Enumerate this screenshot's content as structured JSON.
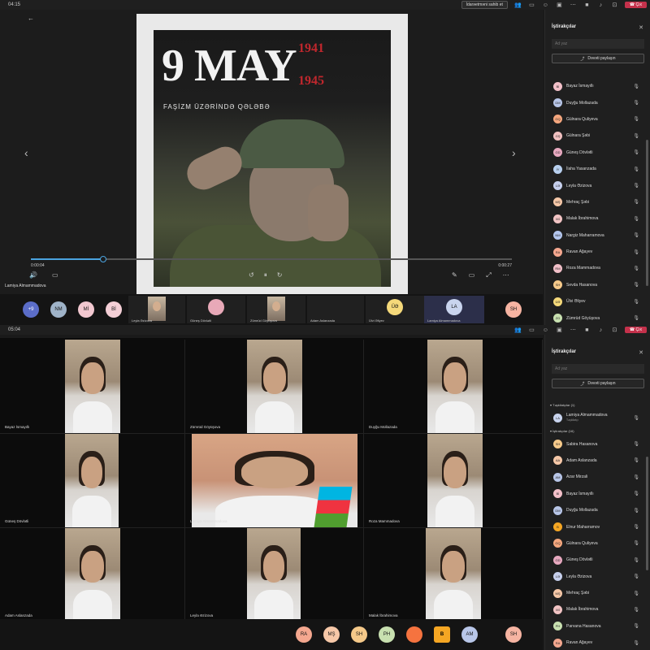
{
  "top": {
    "timer": "04:15",
    "stop_presenting": "İdarəetməni sahib et",
    "leave": "Çıx",
    "presenter_name": "Lamiya Almammadova",
    "poster": {
      "title": "9 MAY",
      "year1": "1941",
      "year2": "1945",
      "subtitle": "FAŞİZM ÜZƏRİNDƏ QƏLƏBƏ"
    },
    "video": {
      "elapsed": "0:00:04",
      "total": "0:00:27",
      "progress": 0.15
    },
    "gallery": {
      "overflow": "+9",
      "avatars": [
        {
          "initials": "NM",
          "color": "#9fb3c8"
        },
        {
          "initials": "Mİ",
          "color": "#f2c8d0"
        },
        {
          "initials": "Bİ",
          "color": "#f4cfd6"
        }
      ],
      "tiles": [
        {
          "name": "Leyla Əzizova"
        },
        {
          "name": "Güneş Dövlətli",
          "initials": "",
          "color": "#e8a9b8"
        },
        {
          "name": "Zümrüd Göyüşova"
        },
        {
          "name": "Adam Aslanzada"
        },
        {
          "name": "Ülvi Əliyev",
          "initials": "ÜƏ",
          "color": "#f5d97a"
        },
        {
          "name": "Lamiya Almammadova",
          "initials": "LA",
          "color": "#c9d4ee"
        }
      ],
      "last_avatar": {
        "initials": "SH",
        "color": "#f6b4a2"
      }
    },
    "panel": {
      "title": "İştirakçılar",
      "search_placeholder": "Ad yaz",
      "share": "Dəvəti paylaşın",
      "people": [
        {
          "name": "Bayaz İsmayıllı",
          "initials": "Bİ",
          "color": "#f3c0c9"
        },
        {
          "name": "Duyğu Mollazada",
          "initials": "DM",
          "color": "#b8c6e8"
        },
        {
          "name": "Gülnara Quliyeva",
          "initials": "GQ",
          "color": "#f5a77e"
        },
        {
          "name": "Gülnara Şəbi",
          "initials": "GŞ",
          "color": "#f2c1c1"
        },
        {
          "name": "Güneş Dövlətli",
          "initials": "GD",
          "color": "#e8a9c0"
        },
        {
          "name": "İlaha Yasanzada",
          "initials": "İY",
          "color": "#b8d0ef"
        },
        {
          "name": "Leyla Əzizova",
          "initials": "LƏ",
          "color": "#c6cfec"
        },
        {
          "name": "Mehraç Şəbi",
          "initials": "MŞ",
          "color": "#f6c8a8"
        },
        {
          "name": "Malak İbrahimova",
          "initials": "Mİ",
          "color": "#f2c4c4"
        },
        {
          "name": "Nargiz Maharramova",
          "initials": "NM",
          "color": "#b4c6ee"
        },
        {
          "name": "Ravan Ağayev",
          "initials": "RA",
          "color": "#f4a78f"
        },
        {
          "name": "Roza Mammadova",
          "initials": "RM",
          "color": "#f2c0c9"
        },
        {
          "name": "Sevda Hasanova",
          "initials": "SH",
          "color": "#f5c98a"
        },
        {
          "name": "Ülvi Əliyev",
          "initials": "ÜƏ",
          "color": "#f5d97a"
        },
        {
          "name": "Zümrüd Göyüşova",
          "initials": "ZG",
          "color": "#c8e0b0"
        }
      ]
    }
  },
  "bottom": {
    "timer": "05:04",
    "leave": "Çıx",
    "cells": [
      {
        "name": "Bayaz İsmayıllı"
      },
      {
        "name": "Zümrüd Göyüşova"
      },
      {
        "name": "Duyğu Mollazada"
      },
      {
        "name": "Güneş Dövlətli"
      },
      {
        "name": "Lamiya Almammadova"
      },
      {
        "name": "Roza Mammadova"
      },
      {
        "name": "Adam Aslanzada"
      },
      {
        "name": "Leyla Əzizova"
      },
      {
        "name": "Malak İbrahimova"
      }
    ],
    "strip": [
      {
        "initials": "RA",
        "color": "#f4a78f"
      },
      {
        "initials": "MŞ",
        "color": "#f6c8a8"
      },
      {
        "initials": "SH",
        "color": "#f5c98a"
      },
      {
        "initials": "PH",
        "color": "#c8e0b0"
      },
      {
        "initials": "",
        "color": "#f5733f"
      },
      {
        "initials": "B",
        "color": "#f5a623"
      },
      {
        "initials": "AM",
        "color": "#b8c6e8"
      },
      {
        "initials": "SH",
        "color": "#f6b4a2"
      }
    ],
    "panel": {
      "title": "İştirakçılar",
      "search_placeholder": "Ad yaz",
      "share": "Dəvəti paylaşın",
      "organizers_label": "Təşkilatçılar (1)",
      "organizer": {
        "name": "Lamiya Almammadova",
        "role": "Təşkilatçı",
        "initials": "LA",
        "color": "#c9d4ee"
      },
      "attendees_label": "İştirakçılar (16)",
      "people": [
        {
          "name": "Sabira Hasanova",
          "initials": "SH",
          "color": "#f5c98a"
        },
        {
          "name": "Adam Aslanzada",
          "initials": "AA",
          "color": "#f6c8a8"
        },
        {
          "name": "Azar Mirzali",
          "initials": "AM",
          "color": "#b8c6e8"
        },
        {
          "name": "Bayaz İsmayıllı",
          "initials": "Bİ",
          "color": "#f3c0c9"
        },
        {
          "name": "Duyğu Mollazada",
          "initials": "DM",
          "color": "#b8c6e8"
        },
        {
          "name": "Elnur Maharramov",
          "initials": "B",
          "color": "#f5a623"
        },
        {
          "name": "Gülnara Quliyeva",
          "initials": "GQ",
          "color": "#f5a77e"
        },
        {
          "name": "Güneş Dövlətli",
          "initials": "GD",
          "color": "#e8a9c0"
        },
        {
          "name": "Leyla Əzizova",
          "initials": "LƏ",
          "color": "#c6cfec"
        },
        {
          "name": "Mehraç Şəbi",
          "initials": "MŞ",
          "color": "#f6c8a8"
        },
        {
          "name": "Malak İbrahimova",
          "initials": "Mİ",
          "color": "#f2c4c4"
        },
        {
          "name": "Parvana Hasanova",
          "initials": "PH",
          "color": "#c8e0b0"
        },
        {
          "name": "Ravan Ağayev",
          "initials": "RA",
          "color": "#f4a78f"
        }
      ]
    }
  }
}
